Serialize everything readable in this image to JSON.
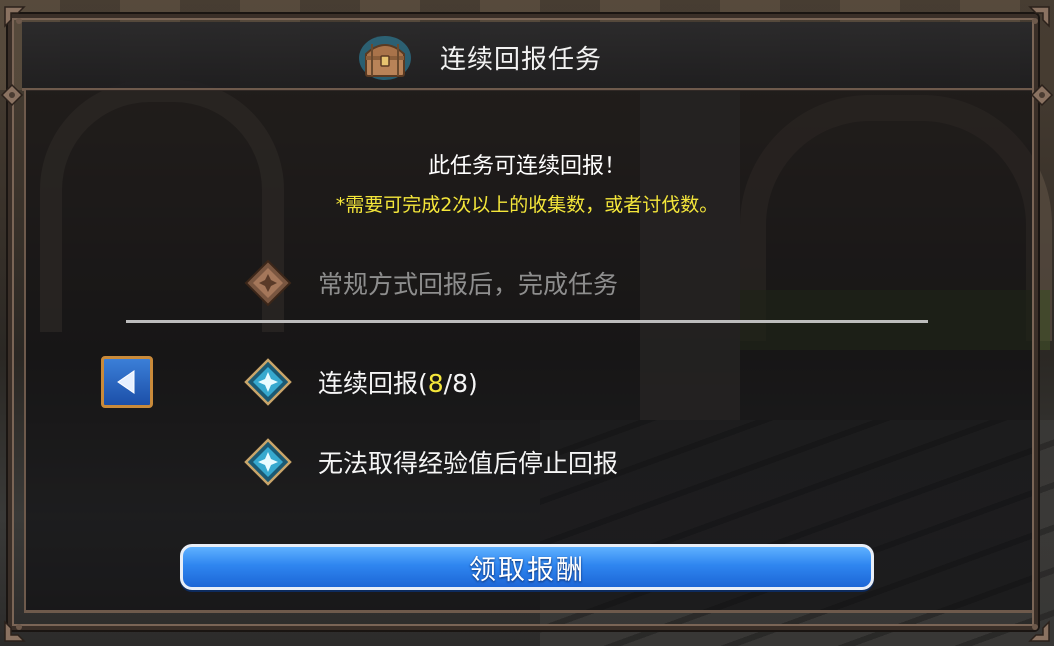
{
  "dialog": {
    "title": "连续回报任务",
    "title_icon": "treasure-chest-icon"
  },
  "message": {
    "headline": "此任务可连续回报！",
    "requirement": "*需要可完成2次以上的收集数，或者讨伐数。"
  },
  "options": {
    "normal": {
      "label": "常规方式回报后，完成任务",
      "icon": "bronze-diamond-icon",
      "enabled": false
    },
    "continuous": {
      "label_prefix": "连续回报(",
      "count_current": "8",
      "count_sep": "/8)",
      "icon": "blue-diamond-icon",
      "selected": true
    },
    "stop": {
      "label": "无法取得经验值后停止回报",
      "icon": "blue-diamond-icon"
    }
  },
  "buttons": {
    "back_icon": "left-arrow-icon",
    "claim_label": "领取报酬"
  },
  "colors": {
    "highlight": "#f4e63a",
    "button_blue": "#2f86f0",
    "frame": "#6e5a4c"
  }
}
